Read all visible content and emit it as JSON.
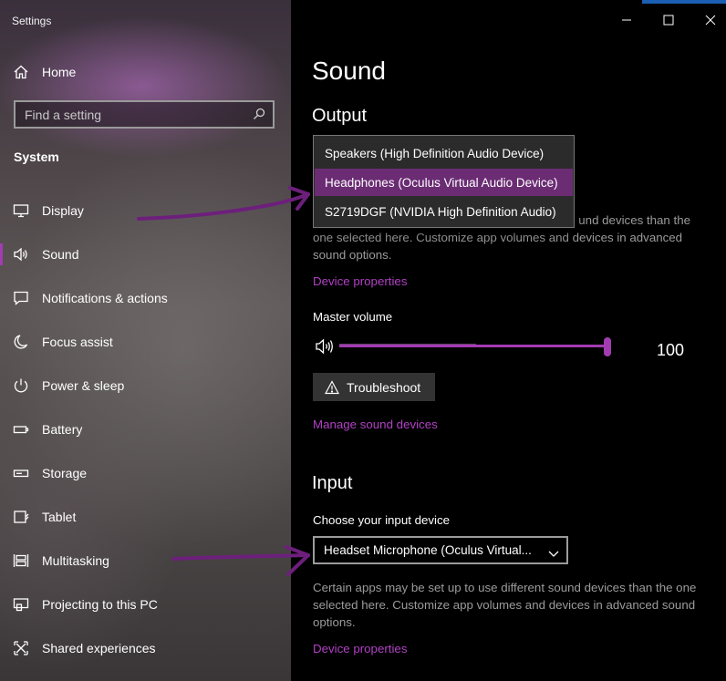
{
  "window": {
    "title": "Settings"
  },
  "nav": {
    "home_label": "Home",
    "search_placeholder": "Find a setting",
    "section_label": "System",
    "items": [
      {
        "label": "Display",
        "icon": "monitor-icon"
      },
      {
        "label": "Sound",
        "icon": "speaker-icon",
        "active": true
      },
      {
        "label": "Notifications & actions",
        "icon": "notification-icon"
      },
      {
        "label": "Focus assist",
        "icon": "moon-icon"
      },
      {
        "label": "Power & sleep",
        "icon": "power-icon"
      },
      {
        "label": "Battery",
        "icon": "battery-icon"
      },
      {
        "label": "Storage",
        "icon": "storage-icon"
      },
      {
        "label": "Tablet",
        "icon": "tablet-icon"
      },
      {
        "label": "Multitasking",
        "icon": "multitasking-icon"
      },
      {
        "label": "Projecting to this PC",
        "icon": "projecting-icon"
      },
      {
        "label": "Shared experiences",
        "icon": "shared-experiences-icon"
      }
    ]
  },
  "main": {
    "title": "Sound",
    "output": {
      "heading": "Output",
      "dropdown_options": [
        "Speakers (High Definition Audio Device)",
        "Headphones (Oculus Virtual Audio Device)",
        "S2719DGF (NVIDIA High Definition Audio)"
      ],
      "selected_option": "Headphones (Oculus Virtual Audio Device)",
      "desc_tail": "und devices than the",
      "desc_rest": "one selected here. Customize app volumes and devices in advanced sound options.",
      "device_properties": "Device properties",
      "master_volume_label": "Master volume",
      "volume_value": "100",
      "volume_fraction": 1.0,
      "troubleshoot_label": "Troubleshoot",
      "manage_devices": "Manage sound devices"
    },
    "input": {
      "heading": "Input",
      "choose_label": "Choose your input device",
      "selected_device": "Headset Microphone (Oculus Virtual...",
      "desc": "Certain apps may be set up to use different sound devices than the one selected here. Customize app volumes and devices in advanced sound options.",
      "device_properties": "Device properties"
    }
  },
  "colors": {
    "accent": "#a33bb3",
    "link": "#b140c4",
    "selected_option_bg": "#6b2c74",
    "annotation": "#6d1f7c"
  }
}
